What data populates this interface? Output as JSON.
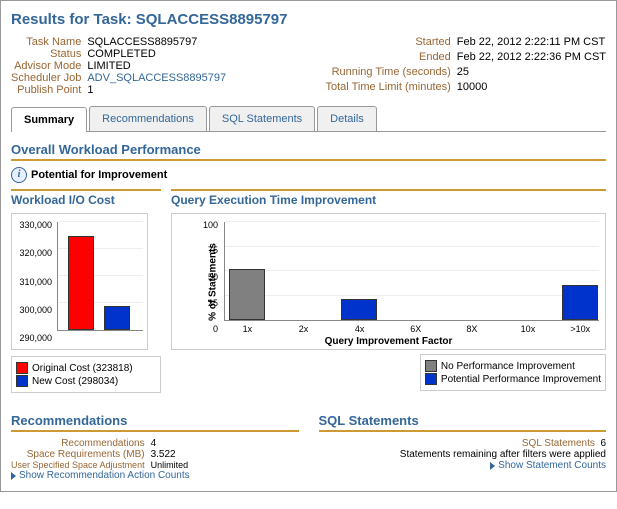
{
  "page_title": "Results for Task: SQLACCESS8895797",
  "meta_left": {
    "task_name_label": "Task Name",
    "task_name": "SQLACCESS8895797",
    "status_label": "Status",
    "status": "COMPLETED",
    "advisor_mode_label": "Advisor Mode",
    "advisor_mode": "LIMITED",
    "scheduler_job_label": "Scheduler Job",
    "scheduler_job": "ADV_SQLACCESS8895797",
    "publish_point_label": "Publish Point",
    "publish_point": "1"
  },
  "meta_right": {
    "started_label": "Started",
    "started": "Feb 22, 2012 2:22:11 PM CST",
    "ended_label": "Ended",
    "ended": "Feb 22, 2012 2:22:36 PM CST",
    "running_label": "Running Time (seconds)",
    "running": "25",
    "limit_label": "Total Time Limit (minutes)",
    "limit": "10000"
  },
  "tabs": {
    "summary": "Summary",
    "recommendations": "Recommendations",
    "sql_statements": "SQL Statements",
    "details": "Details"
  },
  "overall_head": "Overall Workload Performance",
  "potential_head": "Potential for Improvement",
  "chart1_title": "Workload I/O Cost",
  "chart2_title": "Query Execution Time Improvement",
  "chart_data": [
    {
      "type": "bar",
      "title": "Workload I/O Cost",
      "ylabel": "",
      "ylim": [
        290000,
        330000
      ],
      "yticks": [
        "290,000",
        "300,000",
        "310,000",
        "320,000",
        "330,000"
      ],
      "series": [
        {
          "name": "Original Cost (323818)",
          "color": "#ff0000",
          "value": 323818
        },
        {
          "name": "New Cost (298034)",
          "color": "#0033cc",
          "value": 298034
        }
      ]
    },
    {
      "type": "bar",
      "title": "Query Execution Time Improvement",
      "xlabel": "Query Improvement Factor",
      "ylabel": "% of Statements",
      "ylim": [
        0,
        100
      ],
      "yticks": [
        0,
        25,
        50,
        75,
        100
      ],
      "categories": [
        "1x",
        "2x",
        "4x",
        "6X",
        "8X",
        "10x",
        ">10x"
      ],
      "series": [
        {
          "name": "No Performance Improvement",
          "color": "#808080",
          "values": [
            50,
            0,
            0,
            0,
            0,
            0,
            0
          ]
        },
        {
          "name": "Potential Performance Improvement",
          "color": "#0033cc",
          "values": [
            0,
            0,
            19,
            0,
            0,
            0,
            34
          ]
        }
      ]
    }
  ],
  "legend1": {
    "orig": "Original Cost (323818)",
    "new": "New Cost (298034)"
  },
  "legend2": {
    "nop": "No Performance Improvement",
    "pot": "Potential Performance Improvement"
  },
  "rec_section": {
    "head": "Recommendations",
    "recs_label": "Recommendations",
    "recs": "4",
    "space_label": "Space Requirements (MB)",
    "space": "3.522",
    "adj_label": "User Specified Space Adjustment",
    "adj": "Unlimited",
    "show": "Show Recommendation Action Counts"
  },
  "sql_section": {
    "head": "SQL Statements",
    "sql_label": "SQL Statements",
    "sql": "6",
    "remain": "Statements remaining after filters were applied",
    "show": "Show Statement Counts"
  }
}
